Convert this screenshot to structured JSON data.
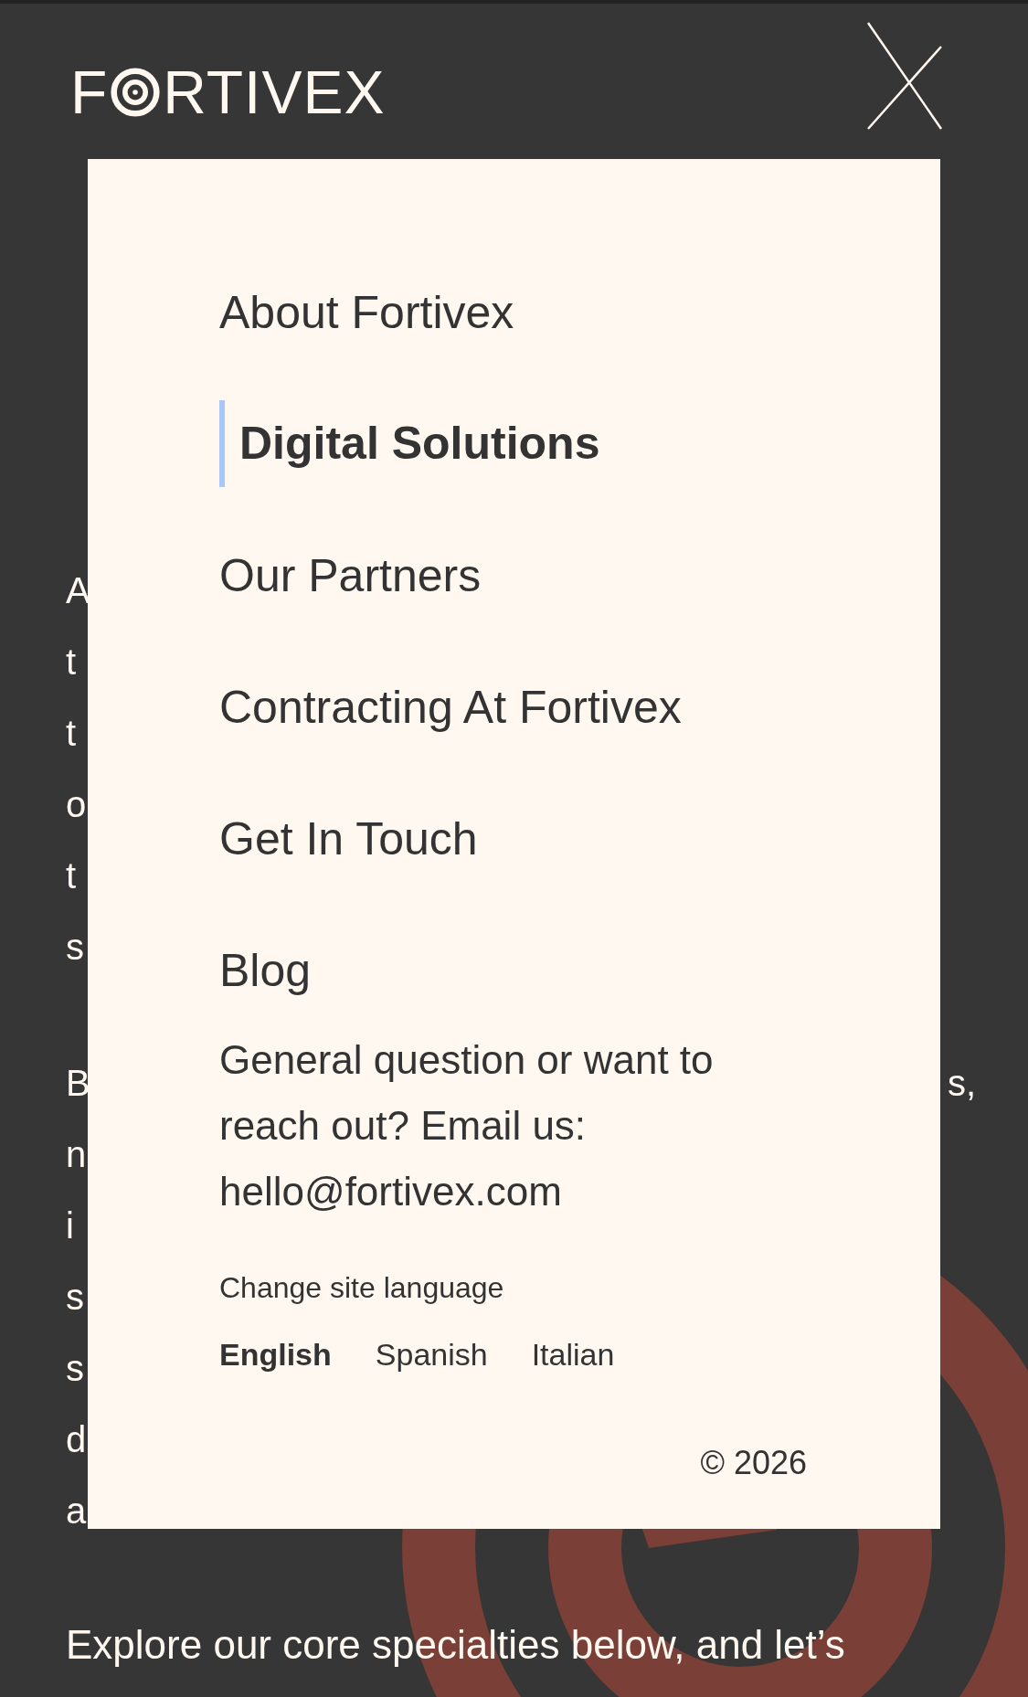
{
  "header": {
    "logo": {
      "before": "F",
      "after": "RTIVEX"
    }
  },
  "background_text": {
    "paragraphs": [
      {
        "lines": [
          {
            "left": "A"
          },
          {
            "left": "t"
          },
          {
            "left": "t"
          },
          {
            "left": "o"
          },
          {
            "left": "t"
          },
          {
            "left": "s"
          }
        ]
      },
      {
        "lines": [
          {
            "left": "B",
            "right": "s,"
          },
          {
            "left": "n"
          },
          {
            "left": "i"
          },
          {
            "left": "s"
          },
          {
            "left": "s"
          },
          {
            "left": "d"
          },
          {
            "left": "a"
          }
        ]
      }
    ],
    "last_line": "Explore our core specialties below, and let’s"
  },
  "menu": {
    "items": [
      {
        "label": "About Fortivex",
        "selected": false
      },
      {
        "label": "Digital Solutions",
        "selected": true
      },
      {
        "label": "Our Partners",
        "selected": false
      },
      {
        "label": "Contracting At Fortivex",
        "selected": false
      },
      {
        "label": "Get In Touch",
        "selected": false
      },
      {
        "label": "Blog",
        "selected": false
      }
    ],
    "contact": [
      "General question or want to",
      "reach out? Email us:",
      "hello@fortivex.com"
    ],
    "language_label": "Change site language",
    "languages": [
      {
        "label": "English",
        "selected": true
      },
      {
        "label": "Spanish",
        "selected": false
      },
      {
        "label": "Italian",
        "selected": false
      }
    ],
    "copyright": "© 2026"
  }
}
